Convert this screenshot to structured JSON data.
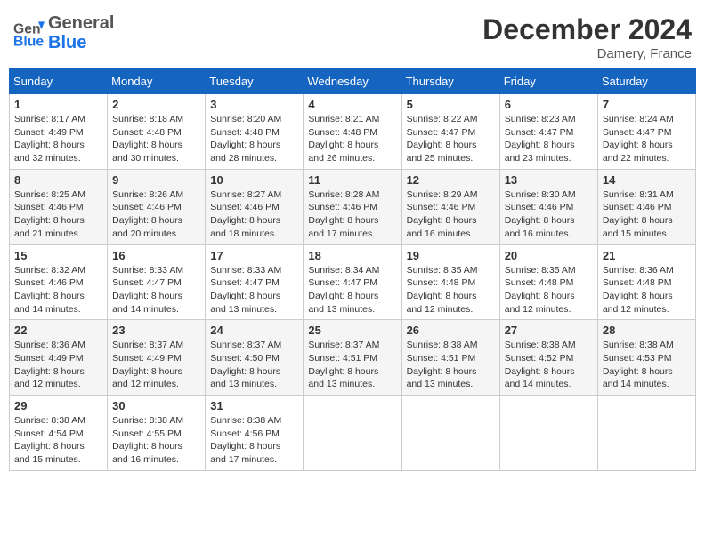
{
  "header": {
    "logo_general": "General",
    "logo_blue": "Blue",
    "month": "December 2024",
    "location": "Damery, France"
  },
  "days_of_week": [
    "Sunday",
    "Monday",
    "Tuesday",
    "Wednesday",
    "Thursday",
    "Friday",
    "Saturday"
  ],
  "weeks": [
    [
      {
        "day": "1",
        "sunrise": "8:17 AM",
        "sunset": "4:49 PM",
        "daylight": "8 hours and 32 minutes."
      },
      {
        "day": "2",
        "sunrise": "8:18 AM",
        "sunset": "4:48 PM",
        "daylight": "8 hours and 30 minutes."
      },
      {
        "day": "3",
        "sunrise": "8:20 AM",
        "sunset": "4:48 PM",
        "daylight": "8 hours and 28 minutes."
      },
      {
        "day": "4",
        "sunrise": "8:21 AM",
        "sunset": "4:48 PM",
        "daylight": "8 hours and 26 minutes."
      },
      {
        "day": "5",
        "sunrise": "8:22 AM",
        "sunset": "4:47 PM",
        "daylight": "8 hours and 25 minutes."
      },
      {
        "day": "6",
        "sunrise": "8:23 AM",
        "sunset": "4:47 PM",
        "daylight": "8 hours and 23 minutes."
      },
      {
        "day": "7",
        "sunrise": "8:24 AM",
        "sunset": "4:47 PM",
        "daylight": "8 hours and 22 minutes."
      }
    ],
    [
      {
        "day": "8",
        "sunrise": "8:25 AM",
        "sunset": "4:46 PM",
        "daylight": "8 hours and 21 minutes."
      },
      {
        "day": "9",
        "sunrise": "8:26 AM",
        "sunset": "4:46 PM",
        "daylight": "8 hours and 20 minutes."
      },
      {
        "day": "10",
        "sunrise": "8:27 AM",
        "sunset": "4:46 PM",
        "daylight": "8 hours and 18 minutes."
      },
      {
        "day": "11",
        "sunrise": "8:28 AM",
        "sunset": "4:46 PM",
        "daylight": "8 hours and 17 minutes."
      },
      {
        "day": "12",
        "sunrise": "8:29 AM",
        "sunset": "4:46 PM",
        "daylight": "8 hours and 16 minutes."
      },
      {
        "day": "13",
        "sunrise": "8:30 AM",
        "sunset": "4:46 PM",
        "daylight": "8 hours and 16 minutes."
      },
      {
        "day": "14",
        "sunrise": "8:31 AM",
        "sunset": "4:46 PM",
        "daylight": "8 hours and 15 minutes."
      }
    ],
    [
      {
        "day": "15",
        "sunrise": "8:32 AM",
        "sunset": "4:46 PM",
        "daylight": "8 hours and 14 minutes."
      },
      {
        "day": "16",
        "sunrise": "8:33 AM",
        "sunset": "4:47 PM",
        "daylight": "8 hours and 14 minutes."
      },
      {
        "day": "17",
        "sunrise": "8:33 AM",
        "sunset": "4:47 PM",
        "daylight": "8 hours and 13 minutes."
      },
      {
        "day": "18",
        "sunrise": "8:34 AM",
        "sunset": "4:47 PM",
        "daylight": "8 hours and 13 minutes."
      },
      {
        "day": "19",
        "sunrise": "8:35 AM",
        "sunset": "4:48 PM",
        "daylight": "8 hours and 12 minutes."
      },
      {
        "day": "20",
        "sunrise": "8:35 AM",
        "sunset": "4:48 PM",
        "daylight": "8 hours and 12 minutes."
      },
      {
        "day": "21",
        "sunrise": "8:36 AM",
        "sunset": "4:48 PM",
        "daylight": "8 hours and 12 minutes."
      }
    ],
    [
      {
        "day": "22",
        "sunrise": "8:36 AM",
        "sunset": "4:49 PM",
        "daylight": "8 hours and 12 minutes."
      },
      {
        "day": "23",
        "sunrise": "8:37 AM",
        "sunset": "4:49 PM",
        "daylight": "8 hours and 12 minutes."
      },
      {
        "day": "24",
        "sunrise": "8:37 AM",
        "sunset": "4:50 PM",
        "daylight": "8 hours and 13 minutes."
      },
      {
        "day": "25",
        "sunrise": "8:37 AM",
        "sunset": "4:51 PM",
        "daylight": "8 hours and 13 minutes."
      },
      {
        "day": "26",
        "sunrise": "8:38 AM",
        "sunset": "4:51 PM",
        "daylight": "8 hours and 13 minutes."
      },
      {
        "day": "27",
        "sunrise": "8:38 AM",
        "sunset": "4:52 PM",
        "daylight": "8 hours and 14 minutes."
      },
      {
        "day": "28",
        "sunrise": "8:38 AM",
        "sunset": "4:53 PM",
        "daylight": "8 hours and 14 minutes."
      }
    ],
    [
      {
        "day": "29",
        "sunrise": "8:38 AM",
        "sunset": "4:54 PM",
        "daylight": "8 hours and 15 minutes."
      },
      {
        "day": "30",
        "sunrise": "8:38 AM",
        "sunset": "4:55 PM",
        "daylight": "8 hours and 16 minutes."
      },
      {
        "day": "31",
        "sunrise": "8:38 AM",
        "sunset": "4:56 PM",
        "daylight": "8 hours and 17 minutes."
      },
      null,
      null,
      null,
      null
    ]
  ]
}
